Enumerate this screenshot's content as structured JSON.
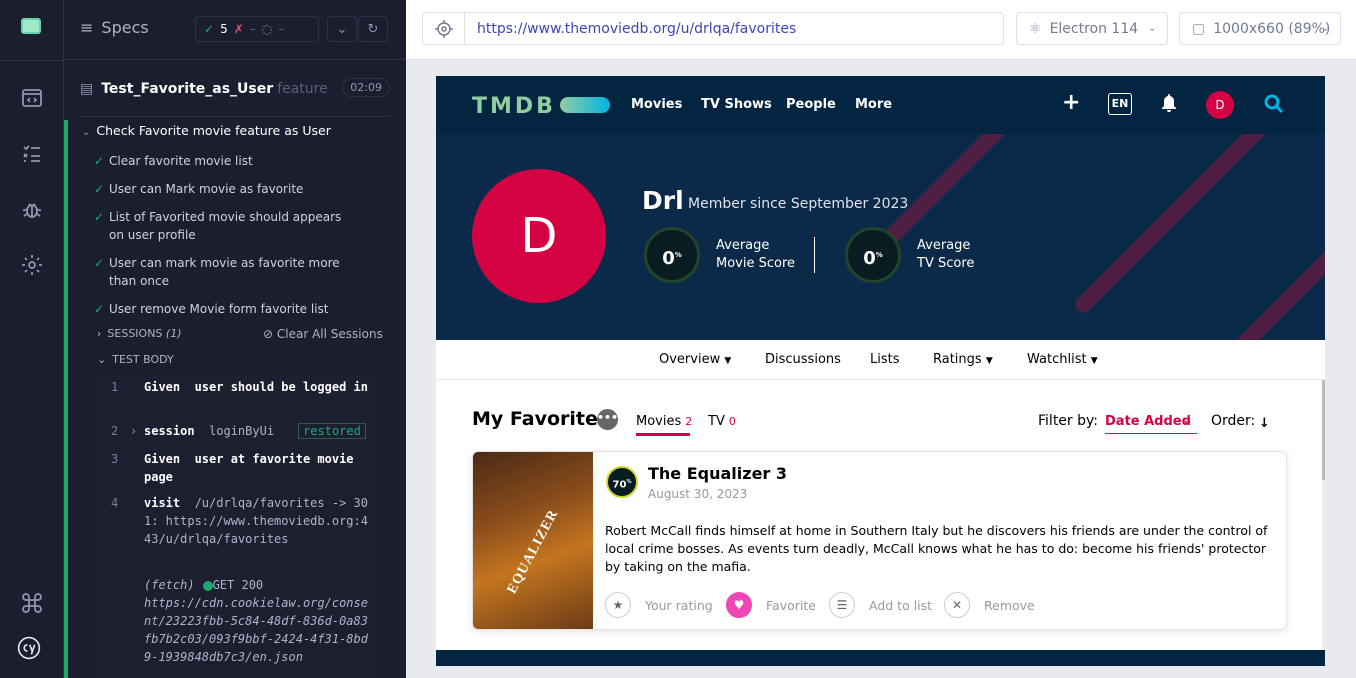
{
  "reporter": {
    "specs_label": "Specs",
    "passed": "5",
    "failed": "–",
    "pending": "–",
    "spec_file": "Test_Favorite_as_User",
    "spec_ext": "feature",
    "duration": "02:09",
    "suite_title": "Check Favorite movie feature as User",
    "tests": [
      "Clear favorite movie list",
      "User can Mark movie as favorite",
      "List of Favorited movie should appears on user profile",
      "User can mark movie as favorite more than once",
      "User remove Movie form favorite list"
    ],
    "sessions_label": "SESSIONS",
    "sessions_count": "(1)",
    "clear_sessions": "Clear All Sessions",
    "test_body_label": "TEST BODY",
    "commands": [
      {
        "no": "1",
        "kw": "Given",
        "text": "user should be logged in"
      },
      {
        "no": "2",
        "kw": "session",
        "text": "loginByUi",
        "badge": "restored"
      },
      {
        "no": "3",
        "kw": "Given",
        "text": "user at favorite movie page"
      },
      {
        "no": "4",
        "kw": "visit",
        "text": "/u/drlqa/favorites -> 301: https://www.themoviedb.org:443/u/drlqa/favorites"
      },
      {
        "no": "",
        "kw": "(fetch)",
        "text": "GET 200",
        "url": "https://cdn.cookielaw.org/consent/23223fbb-5c84-48df-836d-0a83fb7b2c03/093f9bbf-2424-4f31-8bd9-1939848db7c3/en.json"
      }
    ]
  },
  "browser": {
    "url": "https://www.themoviedb.org/u/drlqa/favorites",
    "browser_name": "Electron 114",
    "viewport": "1000x660 (89%)"
  },
  "tmdb": {
    "logo": "TMDB",
    "menu": [
      "Movies",
      "TV Shows",
      "People",
      "More"
    ],
    "plus": "+",
    "lang": "EN",
    "avatar_letter": "D",
    "profile": {
      "initial": "D",
      "name": "Drl",
      "member_since": "Member since September 2023",
      "movie_score": "0",
      "movie_score_label_1": "Average",
      "movie_score_label_2": "Movie Score",
      "tv_score": "0",
      "tv_score_label_1": "Average",
      "tv_score_label_2": "TV Score",
      "pct": "%"
    },
    "tabs": [
      "Overview",
      "Discussions",
      "Lists",
      "Ratings",
      "Watchlist"
    ],
    "favorites": {
      "title": "My Favorites",
      "more": "•••",
      "tab_movies": "Movies",
      "movies_count": "2",
      "tab_tv": "TV",
      "tv_count": "0",
      "filter_label": "Filter by:",
      "filter_value": "Date Added",
      "order_label": "Order:",
      "order_arrow": "↓"
    },
    "movie": {
      "poster_title": "EQUALIZER",
      "score": "70",
      "score_pct": "%",
      "title": "The Equalizer 3",
      "date": "August 30, 2023",
      "overview": "Robert McCall finds himself at home in Southern Italy but he discovers his friends are under the control of local crime bosses. As events turn deadly, McCall knows what he has to do: become his friends' protector by taking on the mafia.",
      "actions": [
        "Your rating",
        "Favorite",
        "Add to list",
        "Remove"
      ]
    }
  }
}
